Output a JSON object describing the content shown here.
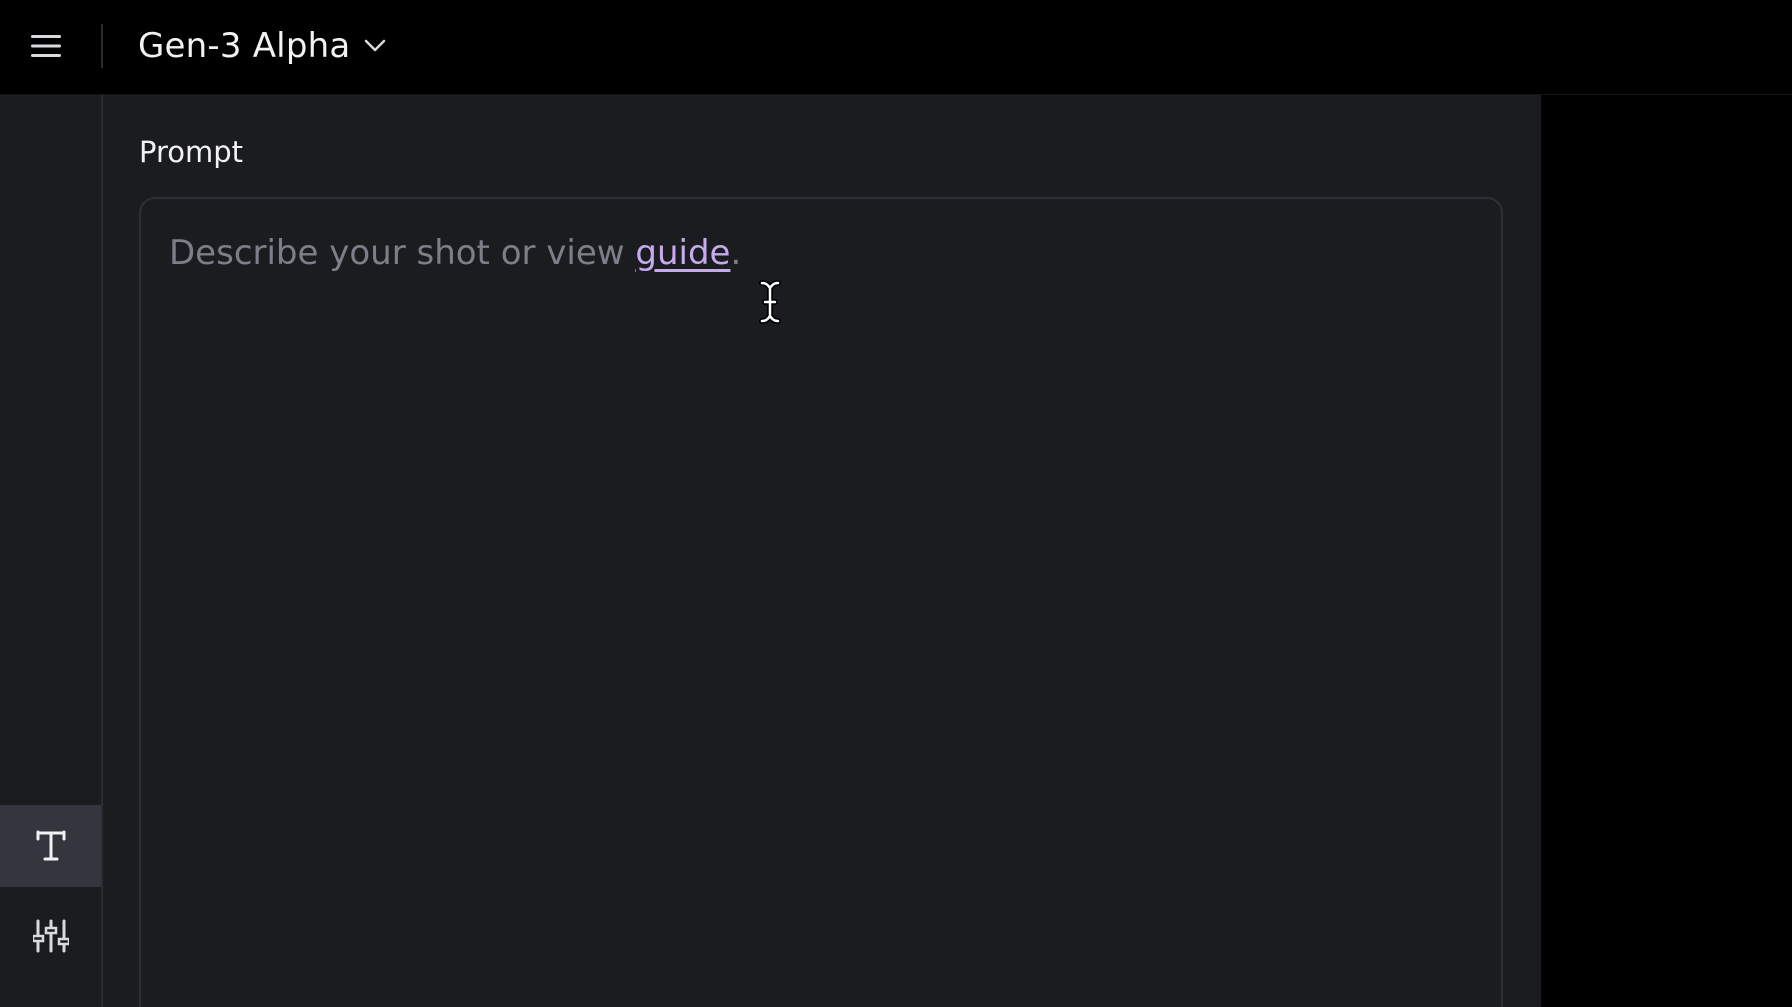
{
  "header": {
    "title": "Gen-3 Alpha",
    "menu_icon": "hamburger-menu-icon",
    "dropdown_icon": "chevron-down-icon"
  },
  "sidebar": {
    "tools": [
      {
        "icon": "text-t-icon",
        "active": true
      },
      {
        "icon": "sliders-icon",
        "active": false
      }
    ]
  },
  "prompt": {
    "label": "Prompt",
    "placeholder_text": "Describe your shot or view ",
    "link_text": "guide",
    "trailing": "."
  },
  "colors": {
    "background": "#000000",
    "panel": "#1b1c20",
    "active_tool": "#35363d",
    "link": "#c7a9f0",
    "placeholder": "#7d7e88",
    "text": "#f2f2f4"
  }
}
